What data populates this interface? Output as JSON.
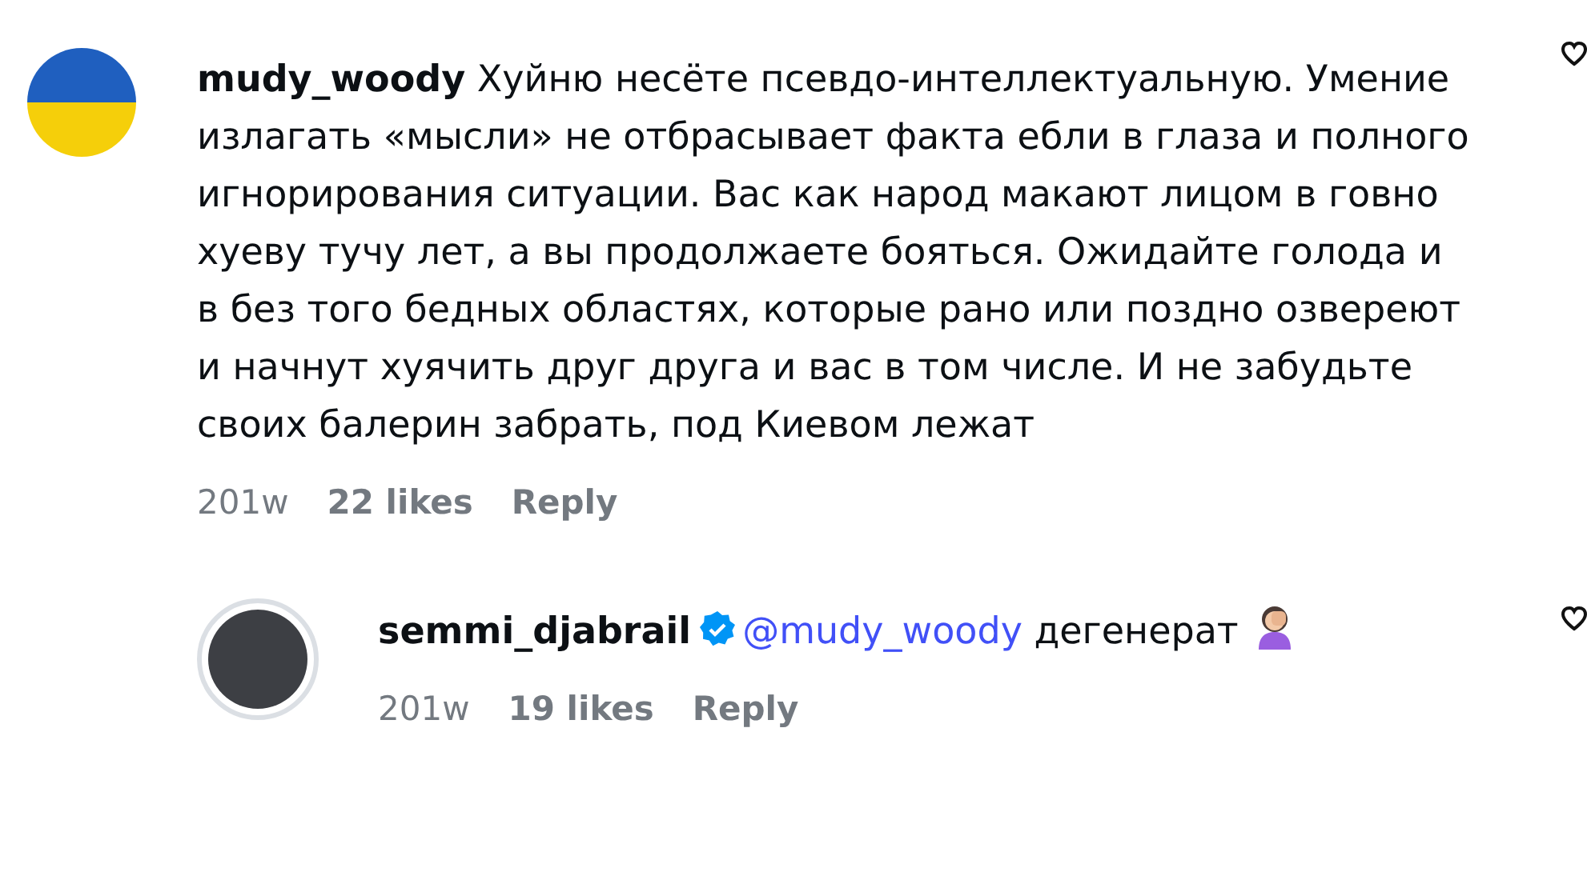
{
  "comments": [
    {
      "username": "mudy_woody",
      "verified": false,
      "kind": "flag",
      "text": "Хуйню несёте псевдо-интеллектуальную. Умение излагать «мысли» не отбрасывает факта ебли в глаза и полного игнорирования ситуации. Вас как народ макают лицом в говно хуеву тучу лет, а вы продолжаете бояться. Ожидайте голода и в без того бедных областях, которые рано или поздно озвереют и начнут хуячить друг друга и вас в том числе. И не забудьте своих балерин забрать, под Киевом лежат",
      "emoji": false,
      "age": "201w",
      "likes": "22 likes",
      "reply": "Reply",
      "replies": [
        {
          "username": "semmi_djabrail",
          "verified": true,
          "kind": "photo",
          "mention": "@mudy_woody",
          "text": "дегенерат",
          "emoji": true,
          "age": "201w",
          "likes": "19 likes",
          "reply": "Reply"
        }
      ]
    }
  ]
}
